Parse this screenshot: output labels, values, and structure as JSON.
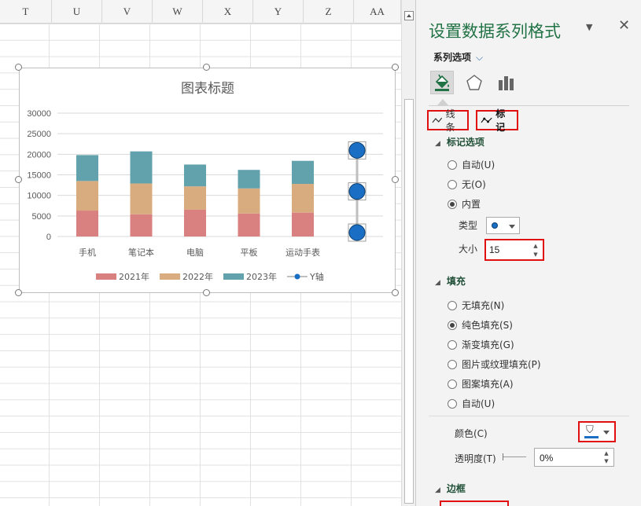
{
  "columns": [
    "T",
    "U",
    "V",
    "W",
    "X",
    "Y",
    "Z",
    "AA"
  ],
  "chart_data": {
    "type": "bar",
    "title": "图表标题",
    "categories": [
      "手机",
      "笔记本",
      "电脑",
      "平板",
      "运动手表"
    ],
    "series": [
      {
        "name": "2021年",
        "values": [
          6300,
          5400,
          6500,
          5600,
          5800
        ],
        "color": "#d98080"
      },
      {
        "name": "2022年",
        "values": [
          7200,
          7500,
          5700,
          6100,
          7000
        ],
        "color": "#d9ac80"
      },
      {
        "name": "2023年",
        "values": [
          6300,
          7800,
          5300,
          4500,
          5600
        ],
        "color": "#61a2ad"
      },
      {
        "name": "Y轴",
        "type": "line-marker",
        "values": [
          0,
          10000,
          20000
        ],
        "color": "#1a6fc4"
      }
    ],
    "stacked": true,
    "ylim": [
      0,
      30000
    ],
    "yticks": [
      "30000",
      "25000",
      "20000",
      "15000",
      "10000",
      "5000",
      "0"
    ],
    "grid": true,
    "legend": "bottom"
  },
  "panel": {
    "title": "设置数据系列格式",
    "dropdown_icon": "chevron-down-icon",
    "close_icon": "close-icon",
    "series_options_label": "系列选项",
    "tabs": [
      "fill-line-icon",
      "effects-pentagon-icon",
      "series-options-bars-icon"
    ],
    "subtab_line": "线条",
    "subtab_marker": "标记",
    "marker_section": "标记选项",
    "marker_options": [
      {
        "label": "自动(U)",
        "checked": false
      },
      {
        "label": "无(O)",
        "checked": false
      },
      {
        "label": "内置",
        "checked": true
      }
    ],
    "type_label": "类型",
    "size_label": "大小",
    "size_value": "15",
    "fill_section": "填充",
    "fill_options": [
      {
        "label": "无填充(N)",
        "checked": false
      },
      {
        "label": "纯色填充(S)",
        "checked": true
      },
      {
        "label": "渐变填充(G)",
        "checked": false
      },
      {
        "label": "图片或纹理填充(P)",
        "checked": false
      },
      {
        "label": "图案填充(A)",
        "checked": false
      },
      {
        "label": "自动(U)",
        "checked": false
      }
    ],
    "color_label": "颜色(C)",
    "color_value": "#1a6fc4",
    "transparency_label": "透明度(T)",
    "transparency_value": "0%",
    "border_section": "边框"
  }
}
